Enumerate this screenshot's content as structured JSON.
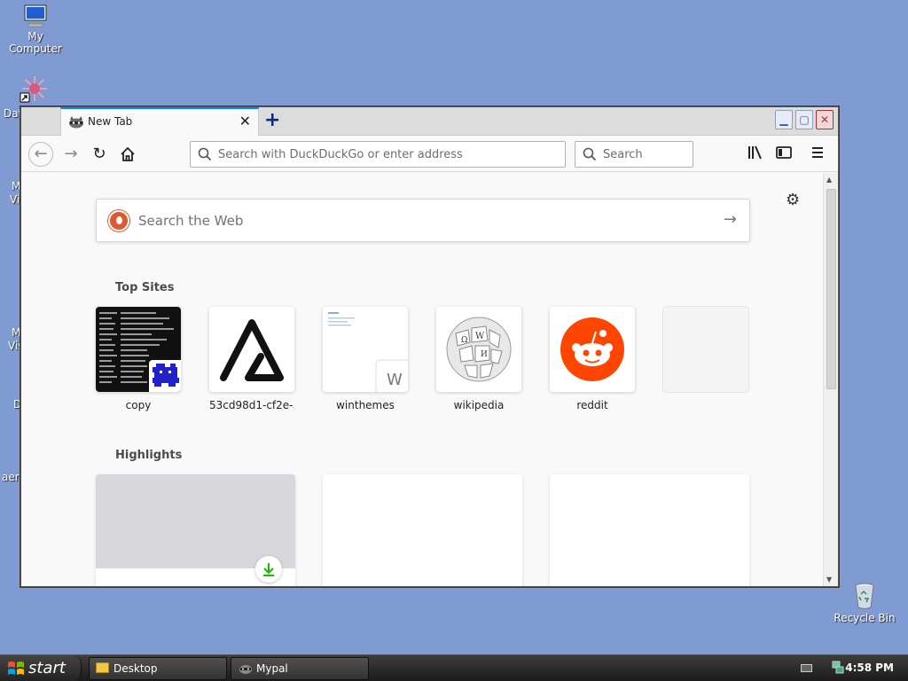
{
  "desktop": {
    "icons": [
      {
        "label": "My Computer"
      },
      {
        "label": "Recycle Bin"
      }
    ],
    "partial_labels": [
      "Dat",
      "M",
      "Vi",
      "M",
      "Vis",
      "D",
      "aero"
    ]
  },
  "browser": {
    "tab": {
      "title": "New Tab"
    },
    "urlbar": {
      "placeholder": "Search with DuckDuckGo or enter address"
    },
    "searchbar": {
      "placeholder": "Search"
    },
    "newtab": {
      "websearch_placeholder": "Search the Web",
      "top_sites_title": "Top Sites",
      "top_sites": [
        {
          "label": "copy"
        },
        {
          "label": "53cd98d1-cf2e-..."
        },
        {
          "label": "winthemes",
          "badge": "W"
        },
        {
          "label": "wikipedia"
        },
        {
          "label": "reddit"
        }
      ],
      "highlights_title": "Highlights"
    }
  },
  "taskbar": {
    "start_label": "start",
    "tasks": [
      {
        "label": "Desktop"
      },
      {
        "label": "Mypal"
      }
    ],
    "clock": "4:58 PM"
  },
  "colors": {
    "desktop": "#7f9bd2",
    "reddit": "#ff4500",
    "accent": "#0a84ff"
  }
}
